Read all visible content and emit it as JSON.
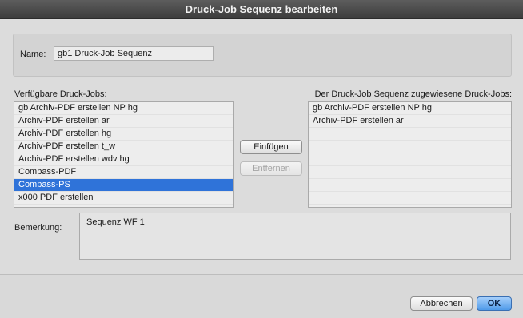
{
  "window": {
    "title": "Druck-Job Sequenz bearbeiten"
  },
  "name": {
    "label": "Name:",
    "value": "gb1 Druck-Job Sequenz"
  },
  "available": {
    "label": "Verfügbare Druck-Jobs:",
    "items": [
      "gb Archiv-PDF erstellen NP hg",
      "Archiv-PDF erstellen ar",
      "Archiv-PDF erstellen hg",
      "Archiv-PDF erstellen t_w",
      "Archiv-PDF erstellen wdv hg",
      "Compass-PDF",
      "Compass-PS",
      "x000 PDF erstellen"
    ],
    "selected_index": 6
  },
  "assigned": {
    "label": "Der Druck-Job Sequenz zugewiesene Druck-Jobs:",
    "items": [
      "gb Archiv-PDF erstellen NP hg",
      "Archiv-PDF erstellen ar"
    ]
  },
  "buttons": {
    "insert": "Einfügen",
    "remove": "Entfernen",
    "cancel": "Abbrechen",
    "ok": "OK"
  },
  "remark": {
    "label": "Bemerkung:",
    "value": "Sequenz WF 1"
  }
}
